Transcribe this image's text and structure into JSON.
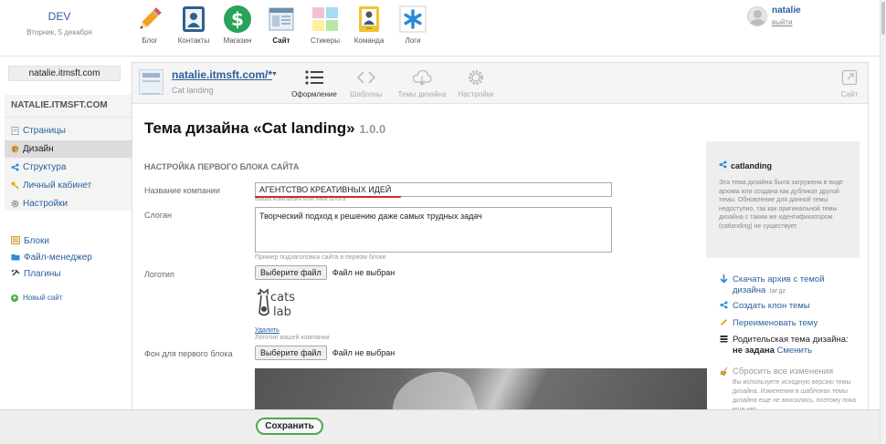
{
  "header": {
    "site_name": "DEV",
    "date": "Вторник, 5 декабря",
    "apps": [
      {
        "label": "Блог",
        "icon": "pencil-icon"
      },
      {
        "label": "Контакты",
        "icon": "contacts-icon"
      },
      {
        "label": "Магазин",
        "icon": "dollar-icon"
      },
      {
        "label": "Сайт",
        "icon": "site-icon",
        "active": true
      },
      {
        "label": "Стикеры",
        "icon": "stickers-icon"
      },
      {
        "label": "Команда",
        "icon": "team-icon"
      },
      {
        "label": "Логи",
        "icon": "logs-icon"
      }
    ],
    "user": {
      "name": "natalie",
      "logout": "выйти"
    }
  },
  "sidebar": {
    "site_domain": "natalie.itmsft.com",
    "panel_title": "NATALIE.ITMSFT.COM",
    "nav": [
      {
        "label": "Страницы",
        "icon": "pages-icon"
      },
      {
        "label": "Дизайн",
        "icon": "palette-icon",
        "selected": true
      },
      {
        "label": "Структура",
        "icon": "structure-icon"
      },
      {
        "label": "Личный кабинет",
        "icon": "key-icon"
      },
      {
        "label": "Настройки",
        "icon": "gear-icon"
      }
    ],
    "tools": [
      {
        "label": "Блоки",
        "icon": "blocks-icon"
      },
      {
        "label": "Файл-менеджер",
        "icon": "file-manager-icon"
      },
      {
        "label": "Плагины",
        "icon": "plugins-icon"
      }
    ],
    "new_site": "Новый сайт"
  },
  "toolbar": {
    "site_url": "natalie.itmsft.com/*",
    "site_sub": "Cat landing",
    "buttons": [
      {
        "label": "Оформление",
        "icon": "list-icon",
        "active": true
      },
      {
        "label": "Шаблоны",
        "icon": "code-icon"
      },
      {
        "label": "Темы дизайна",
        "icon": "cloud-icon"
      },
      {
        "label": "Настройки",
        "icon": "settings-gear-icon"
      }
    ],
    "site_button": {
      "label": "Сайт",
      "icon": "external-link-icon"
    }
  },
  "content": {
    "title": "Тема дизайна «Cat landing»",
    "version": "1.0.0",
    "section": "НАСТРОЙКА ПЕРВОГО БЛОКА САЙТА",
    "fields": {
      "company_label": "Название компании",
      "company_value": "АГЕНТСТВО КРЕАТИВНЫХ ИДЕЙ",
      "company_hint": "Ваша компания или имя блога",
      "slogan_label": "Слоган",
      "slogan_value": "Творческий подход к решению даже самых трудных задач",
      "slogan_hint": "Пример подзаголовка сайта в первом блоке",
      "logo_label": "Логотип",
      "file_button": "Выберите файл",
      "no_file": "Файл не выбран",
      "logo_text_1": "cats",
      "logo_text_2": "lab",
      "delete_link": "Удалить",
      "logo_hint": "Логотип вашей компании",
      "bg_label": "Фон для первого блока"
    }
  },
  "info": {
    "theme_id": "catlanding",
    "description": "Эта тема дизайна была загружена в виде архива или создана как дубликат другой темы. Обновление для данной темы недоступно, так как оригинальной темы дизайна с таким же идентификатором (catlanding) не существует.",
    "actions": {
      "download": "Скачать архив с темой дизайна",
      "download_ext": ".tar.gz",
      "clone": "Создать клон темы",
      "rename": "Переименовать тему",
      "parent_label": "Родительская тема дизайна:",
      "parent_value": "не задана",
      "parent_change": "Сменить",
      "reset": "Сбросить все изменения",
      "reset_desc": "Вы используете исходную версию темы дизайна. Изменения в шаблонах темы дизайна еще не вносились, поэтому пока еще нет"
    }
  },
  "save_label": "Сохранить",
  "colors": {
    "link": "#2b5f9e",
    "accent_green": "#4caa4c",
    "underline_red": "#cf2a2a"
  }
}
